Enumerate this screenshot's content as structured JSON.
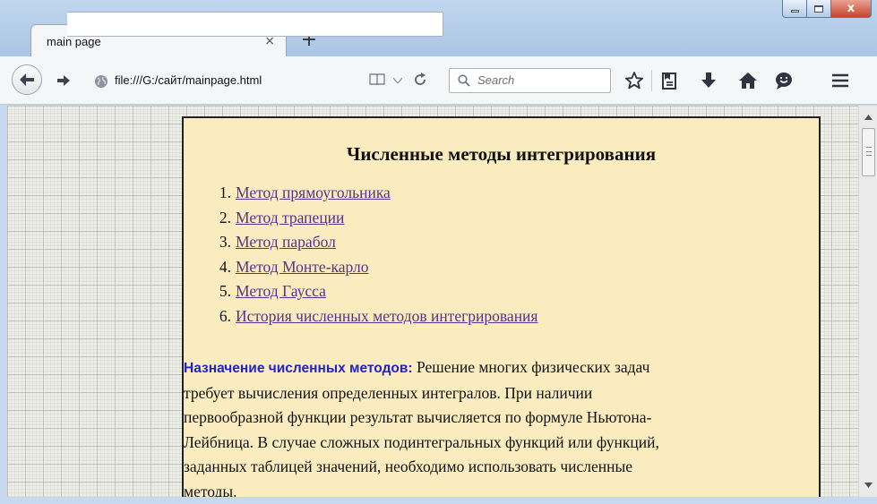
{
  "browser": {
    "tab_title": "main page",
    "tab_close_glyph": "×",
    "new_tab_glyph": "+",
    "url": "file:///G:/сайт/mainpage.html",
    "search_placeholder": "Search",
    "icons": [
      "back-arrow-icon",
      "forward-arrow-icon",
      "globe-icon",
      "reader-view-icon",
      "dropdown-arrow-icon",
      "reload-icon",
      "search-icon",
      "bookmark-star-icon",
      "bookmarks-list-icon",
      "download-icon",
      "home-icon",
      "hello-chat-icon",
      "hamburger-menu-icon"
    ],
    "window_controls": {
      "minimize": "minimize-icon",
      "maximize": "maximize-icon",
      "close": "close-icon",
      "close_glyph": "x"
    }
  },
  "page": {
    "title": "Численные методы интегрирования",
    "methods": [
      {
        "num": "1.",
        "label": "Метод прямоугольника"
      },
      {
        "num": "2.",
        "label": "Метод трапеции"
      },
      {
        "num": "3.",
        "label": "Метод парабол"
      },
      {
        "num": "4.",
        "label": "Метод Монте-карло"
      },
      {
        "num": "5.",
        "label": "Метод Гаусса"
      },
      {
        "num": "6.",
        "label": "История численных методов интегрирования"
      }
    ],
    "description_label": "Назначение численных методов:",
    "description_lines": [
      " Решение многих физических задач",
      "требует вычисления определенных интегралов. При наличии",
      "первообразной функции результат вычисляется по формуле Ньютона-",
      "Лейбница. В случае сложных подинтегральных функций или функций,",
      "заданных таблицей значений, необходимо использовать численные",
      "методы."
    ]
  },
  "colors": {
    "page_background": "#fbecc0",
    "link": "#56338a",
    "label_blue": "#2222cc"
  }
}
